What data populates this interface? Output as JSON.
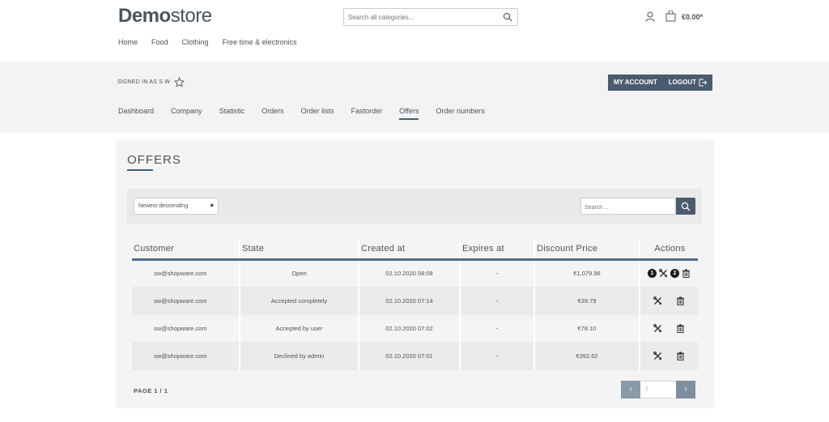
{
  "header": {
    "logo_bold": "Demo",
    "logo_light": "store",
    "search_placeholder": "Search all categories...",
    "cart_total": "€0.00*",
    "nav": [
      "Home",
      "Food",
      "Clothing",
      "Free time & electronics"
    ]
  },
  "account": {
    "signed_in": "SIGNED IN AS S W",
    "my_account": "MY ACCOUNT",
    "logout": "LOGOUT",
    "tabs": [
      "Dashboard",
      "Company",
      "Statistic",
      "Orders",
      "Order lists",
      "Fastorder",
      "Offers",
      "Order numbers"
    ],
    "active_tab": "Offers"
  },
  "offers": {
    "title": "OFFERS",
    "sort_value": "Newest descending",
    "search_placeholder": "Search ...",
    "columns": [
      "Customer",
      "State",
      "Created at",
      "Expires at",
      "Discount Price",
      "Actions"
    ],
    "rows": [
      {
        "customer": "sw@shopware.com",
        "state": "Open",
        "created": "02.10.2020 08:08",
        "expires": "-",
        "price": "€1,079.96"
      },
      {
        "customer": "sw@shopware.com",
        "state": "Accepted completely",
        "created": "02.10.2020 07:14",
        "expires": "-",
        "price": "€39.79"
      },
      {
        "customer": "sw@shopware.com",
        "state": "Accepted by user",
        "created": "02.10.2020 07:02",
        "expires": "-",
        "price": "€78.10"
      },
      {
        "customer": "sw@shopware.com",
        "state": "Declined by admin",
        "created": "02.10.2020 07:01",
        "expires": "-",
        "price": "€392.62"
      }
    ],
    "badges": [
      "1",
      "2"
    ],
    "page_label": "PAGE 1 / 1",
    "page_input": "1"
  },
  "icons": {
    "search": "search-icon",
    "account": "user-icon",
    "cart": "bag-icon",
    "star": "star-icon",
    "logout": "logout-icon",
    "edit": "tools-icon",
    "delete": "trash-icon"
  },
  "colors": {
    "accent": "#3e5f79",
    "button": "#4a5c6e"
  }
}
